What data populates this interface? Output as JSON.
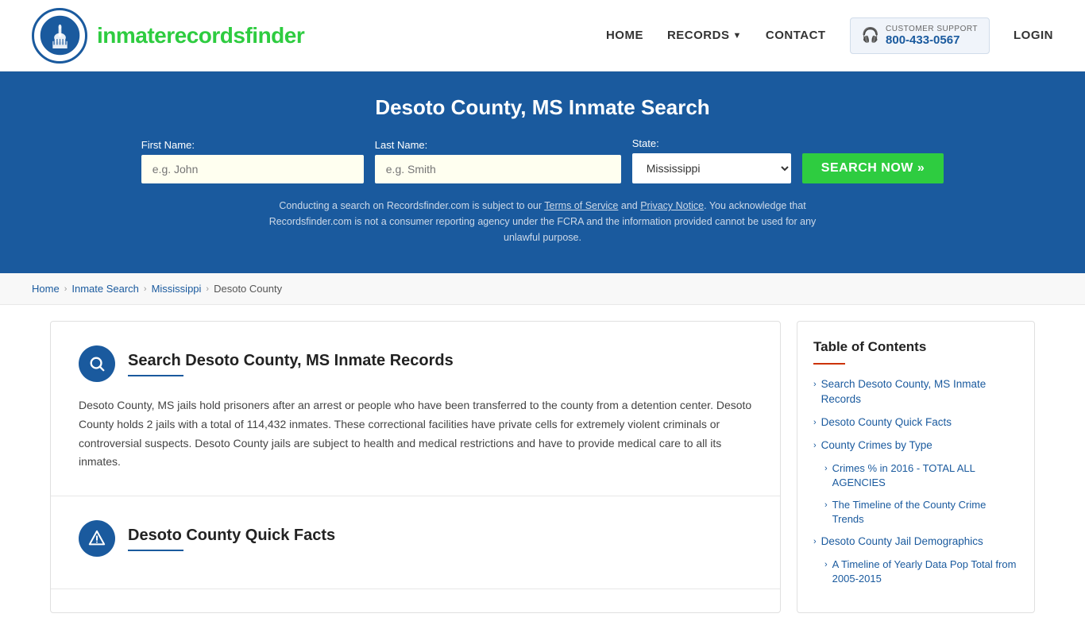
{
  "header": {
    "logo_text_main": "inmaterecords",
    "logo_text_accent": "finder",
    "nav": {
      "home": "HOME",
      "records": "RECORDS",
      "contact": "CONTACT",
      "support_label": "CUSTOMER SUPPORT",
      "support_number": "800-433-0567",
      "login": "LOGIN"
    }
  },
  "hero": {
    "title": "Desoto County, MS Inmate Search",
    "form": {
      "first_name_label": "First Name:",
      "first_name_placeholder": "e.g. John",
      "last_name_label": "Last Name:",
      "last_name_placeholder": "e.g. Smith",
      "state_label": "State:",
      "state_value": "Mississippi",
      "search_btn": "SEARCH NOW »"
    },
    "disclaimer": "Conducting a search on Recordsfinder.com is subject to our Terms of Service and Privacy Notice. You acknowledge that Recordsfinder.com is not a consumer reporting agency under the FCRA and the information provided cannot be used for any unlawful purpose."
  },
  "breadcrumb": {
    "home": "Home",
    "inmate_search": "Inmate Search",
    "mississippi": "Mississippi",
    "current": "Desoto County"
  },
  "sections": [
    {
      "id": "inmate-records",
      "icon": "🔍",
      "title": "Search Desoto County, MS Inmate Records",
      "body": "Desoto County, MS jails hold prisoners after an arrest or people who have been transferred to the county from a detention center. Desoto County holds 2 jails with a total of 114,432 inmates. These correctional facilities have private cells for extremely violent criminals or controversial suspects. Desoto County jails are subject to health and medical restrictions and have to provide medical care to all its inmates."
    },
    {
      "id": "quick-facts",
      "icon": "⚠",
      "title": "Desoto County Quick Facts",
      "body": ""
    }
  ],
  "toc": {
    "title": "Table of Contents",
    "items": [
      {
        "label": "Search Desoto County, MS Inmate Records",
        "sub": false
      },
      {
        "label": "Desoto County Quick Facts",
        "sub": false
      },
      {
        "label": "County Crimes by Type",
        "sub": false
      },
      {
        "label": "Crimes % in 2016 - TOTAL ALL AGENCIES",
        "sub": true
      },
      {
        "label": "The Timeline of the County Crime Trends",
        "sub": true
      },
      {
        "label": "Desoto County Jail Demographics",
        "sub": false
      },
      {
        "label": "A Timeline of Yearly Data Pop Total from 2005-2015",
        "sub": true
      }
    ]
  }
}
